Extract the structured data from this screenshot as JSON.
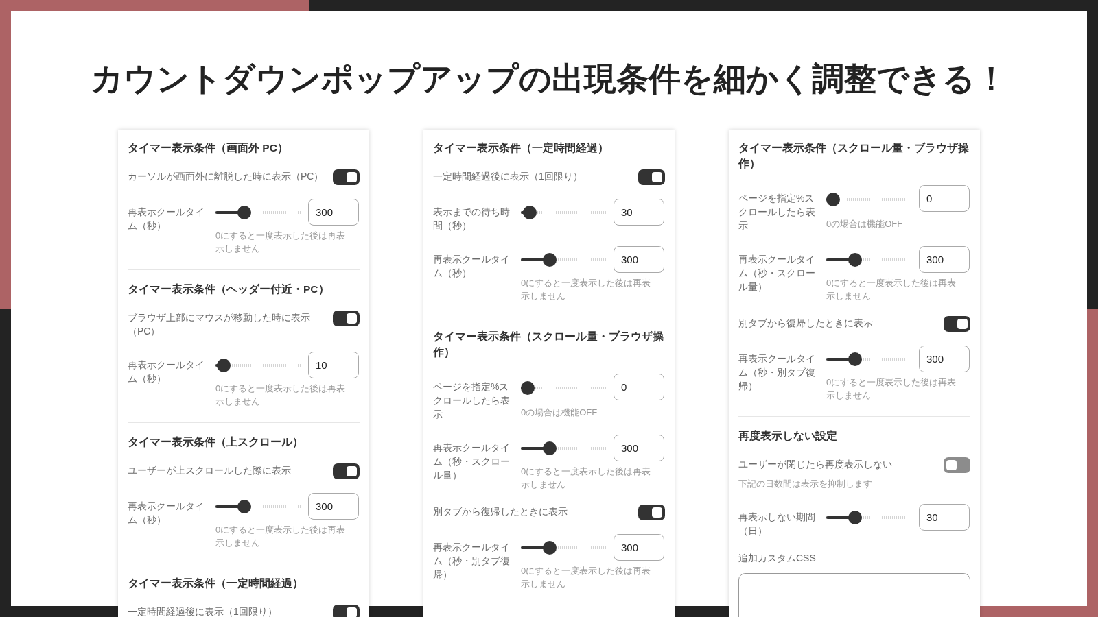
{
  "title": "カウントダウンポップアップの出現条件を細かく調整できる！",
  "panels": [
    {
      "sections": [
        {
          "heading": "タイマー表示条件（画面外 PC）",
          "items": [
            {
              "kind": "toggle",
              "label": "カーソルが画面外に離脱した時に表示（PC）",
              "on": true
            },
            {
              "kind": "slider",
              "label": "再表示クールタイム（秒）",
              "level": 0.3,
              "value": "300",
              "hint": "0にすると一度表示した後は再表示しません"
            }
          ]
        },
        {
          "heading": "タイマー表示条件（ヘッダー付近・PC）",
          "items": [
            {
              "kind": "toggle",
              "label": "ブラウザ上部にマウスが移動した時に表示（PC）",
              "on": true
            },
            {
              "kind": "slider",
              "label": "再表示クールタイム（秒）",
              "level": 0.02,
              "value": "10",
              "hint": "0にすると一度表示した後は再表示しません"
            }
          ]
        },
        {
          "heading": "タイマー表示条件（上スクロール）",
          "items": [
            {
              "kind": "toggle",
              "label": "ユーザーが上スクロールした際に表示",
              "on": true
            },
            {
              "kind": "slider",
              "label": "再表示クールタイム（秒）",
              "level": 0.3,
              "value": "300",
              "hint": "0にすると一度表示した後は再表示しません"
            }
          ]
        },
        {
          "heading": "タイマー表示条件（一定時間経過）",
          "items": [
            {
              "kind": "toggle",
              "label": "一定時間経過後に表示（1回限り）",
              "on": true
            }
          ]
        }
      ]
    },
    {
      "sections": [
        {
          "heading": "タイマー表示条件（一定時間経過）",
          "items": [
            {
              "kind": "toggle",
              "label": "一定時間経過後に表示（1回限り）",
              "on": true
            },
            {
              "kind": "slider",
              "label": "表示までの待ち時間（秒）",
              "level": 0.03,
              "value": "30"
            },
            {
              "kind": "slider",
              "label": "再表示クールタイム（秒）",
              "level": 0.3,
              "value": "300",
              "hint": "0にすると一度表示した後は再表示しません"
            }
          ]
        },
        {
          "heading": "タイマー表示条件（スクロール量・ブラウザ操作）",
          "items": [
            {
              "kind": "slider",
              "label": "ページを指定%スクロールしたら表示",
              "level": 0,
              "value": "0",
              "hint": "0の場合は機能OFF"
            },
            {
              "kind": "slider",
              "label": "再表示クールタイム（秒・スクロール量）",
              "level": 0.3,
              "value": "300",
              "hint": "0にすると一度表示した後は再表示しません"
            },
            {
              "kind": "toggle",
              "label": "別タブから復帰したときに表示",
              "on": true
            },
            {
              "kind": "slider",
              "label": "再表示クールタイム（秒・別タブ復帰）",
              "level": 0.3,
              "value": "300",
              "hint": "0にすると一度表示した後は再表示しません"
            }
          ]
        }
      ]
    },
    {
      "sections": [
        {
          "heading": "タイマー表示条件（スクロール量・ブラウザ操作）",
          "items": [
            {
              "kind": "slider",
              "label": "ページを指定%スクロールしたら表示",
              "level": 0,
              "value": "0",
              "hint": "0の場合は機能OFF"
            },
            {
              "kind": "slider",
              "label": "再表示クールタイム（秒・スクロール量）",
              "level": 0.3,
              "value": "300",
              "hint": "0にすると一度表示した後は再表示しません"
            },
            {
              "kind": "toggle",
              "label": "別タブから復帰したときに表示",
              "on": true
            },
            {
              "kind": "slider",
              "label": "再表示クールタイム（秒・別タブ復帰）",
              "level": 0.3,
              "value": "300",
              "hint": "0にすると一度表示した後は再表示しません"
            }
          ]
        },
        {
          "heading": "再度表示しない設定",
          "items": [
            {
              "kind": "toggle",
              "label": "ユーザーが閉じたら再度表示しない",
              "on": false,
              "hint": "下記の日数間は表示を抑制します"
            },
            {
              "kind": "slider",
              "label": "再表示しない期間（日）",
              "level": 0.3,
              "value": "30"
            },
            {
              "kind": "textarea",
              "label": "追加カスタムCSS"
            }
          ]
        }
      ]
    }
  ]
}
